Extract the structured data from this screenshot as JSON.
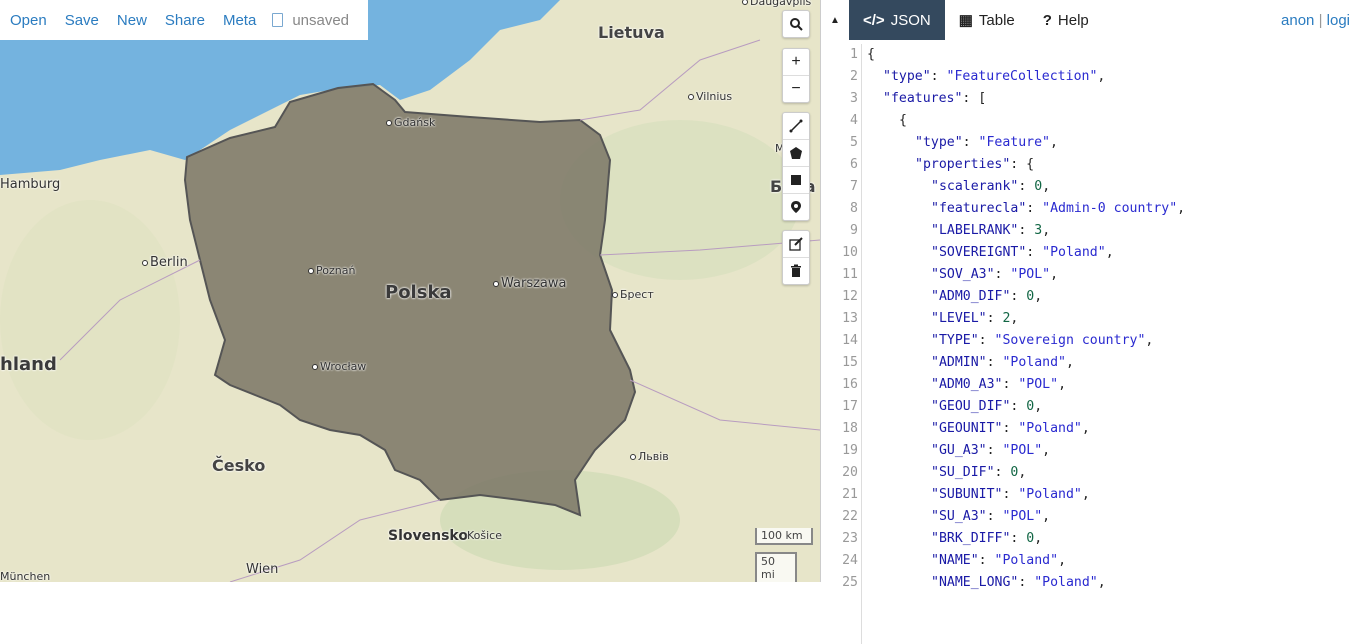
{
  "toolbar": {
    "open": "Open",
    "save": "Save",
    "new": "New",
    "share": "Share",
    "meta": "Meta",
    "unsaved": "unsaved"
  },
  "map": {
    "labels": {
      "daugavpils": "Daugavpils",
      "lietuva": "Lietuva",
      "vilnius": "Vilnius",
      "gdansk": "Gdańsk",
      "hamburg": "Hamburg",
      "berlin": "Berlin",
      "poznan": "Poznań",
      "polska": "Polska",
      "warszawa": "Warszawa",
      "brest": "Брест",
      "hland": "hland",
      "wroclaw": "Wrocław",
      "cesko": "Česko",
      "lviv": "Львів",
      "slovensko": "Slovensko",
      "kosice": "Košice",
      "wien": "Wien",
      "munchen": "München",
      "minsk_partial": "M",
      "belarus_partial": "Бела"
    },
    "scale_km": "100 km",
    "scale_mi": "50 mi",
    "colors": {
      "sea": "#74b3df",
      "land": "#e7e5c9",
      "polygon_fill": "#7a7565",
      "polygon_stroke": "#555555"
    }
  },
  "controls": {
    "search": "search-icon",
    "zoom_in": "+",
    "zoom_out": "−"
  },
  "panel": {
    "tabs": [
      {
        "label": "JSON",
        "icon": "</>"
      },
      {
        "label": "Table",
        "icon": "▦"
      },
      {
        "label": "Help",
        "icon": "?"
      }
    ],
    "user": {
      "anon": "anon",
      "separator": "|",
      "login": "logi"
    }
  },
  "editor": {
    "lines": [
      {
        "n": "1",
        "indent": 0,
        "parts": [
          [
            "p",
            "{"
          ]
        ]
      },
      {
        "n": "2",
        "indent": 1,
        "parts": [
          [
            "k",
            "\"type\""
          ],
          [
            "p",
            ": "
          ],
          [
            "s",
            "\"FeatureCollection\""
          ],
          [
            "p",
            ","
          ]
        ]
      },
      {
        "n": "3",
        "indent": 1,
        "parts": [
          [
            "k",
            "\"features\""
          ],
          [
            "p",
            ": ["
          ]
        ]
      },
      {
        "n": "4",
        "indent": 2,
        "parts": [
          [
            "p",
            "{"
          ]
        ]
      },
      {
        "n": "5",
        "indent": 3,
        "parts": [
          [
            "k",
            "\"type\""
          ],
          [
            "p",
            ": "
          ],
          [
            "s",
            "\"Feature\""
          ],
          [
            "p",
            ","
          ]
        ]
      },
      {
        "n": "6",
        "indent": 3,
        "parts": [
          [
            "k",
            "\"properties\""
          ],
          [
            "p",
            ": {"
          ]
        ]
      },
      {
        "n": "7",
        "indent": 4,
        "parts": [
          [
            "k",
            "\"scalerank\""
          ],
          [
            "p",
            ": "
          ],
          [
            "n",
            "0"
          ],
          [
            "p",
            ","
          ]
        ]
      },
      {
        "n": "8",
        "indent": 4,
        "parts": [
          [
            "k",
            "\"featurecla\""
          ],
          [
            "p",
            ": "
          ],
          [
            "s",
            "\"Admin-0 country\""
          ],
          [
            "p",
            ","
          ]
        ]
      },
      {
        "n": "9",
        "indent": 4,
        "parts": [
          [
            "k",
            "\"LABELRANK\""
          ],
          [
            "p",
            ": "
          ],
          [
            "n",
            "3"
          ],
          [
            "p",
            ","
          ]
        ]
      },
      {
        "n": "10",
        "indent": 4,
        "parts": [
          [
            "k",
            "\"SOVEREIGNT\""
          ],
          [
            "p",
            ": "
          ],
          [
            "s",
            "\"Poland\""
          ],
          [
            "p",
            ","
          ]
        ]
      },
      {
        "n": "11",
        "indent": 4,
        "parts": [
          [
            "k",
            "\"SOV_A3\""
          ],
          [
            "p",
            ": "
          ],
          [
            "s",
            "\"POL\""
          ],
          [
            "p",
            ","
          ]
        ]
      },
      {
        "n": "12",
        "indent": 4,
        "parts": [
          [
            "k",
            "\"ADM0_DIF\""
          ],
          [
            "p",
            ": "
          ],
          [
            "n",
            "0"
          ],
          [
            "p",
            ","
          ]
        ]
      },
      {
        "n": "13",
        "indent": 4,
        "parts": [
          [
            "k",
            "\"LEVEL\""
          ],
          [
            "p",
            ": "
          ],
          [
            "n",
            "2"
          ],
          [
            "p",
            ","
          ]
        ]
      },
      {
        "n": "14",
        "indent": 4,
        "parts": [
          [
            "k",
            "\"TYPE\""
          ],
          [
            "p",
            ": "
          ],
          [
            "s",
            "\"Sovereign country\""
          ],
          [
            "p",
            ","
          ]
        ]
      },
      {
        "n": "15",
        "indent": 4,
        "parts": [
          [
            "k",
            "\"ADMIN\""
          ],
          [
            "p",
            ": "
          ],
          [
            "s",
            "\"Poland\""
          ],
          [
            "p",
            ","
          ]
        ]
      },
      {
        "n": "16",
        "indent": 4,
        "parts": [
          [
            "k",
            "\"ADM0_A3\""
          ],
          [
            "p",
            ": "
          ],
          [
            "s",
            "\"POL\""
          ],
          [
            "p",
            ","
          ]
        ]
      },
      {
        "n": "17",
        "indent": 4,
        "parts": [
          [
            "k",
            "\"GEOU_DIF\""
          ],
          [
            "p",
            ": "
          ],
          [
            "n",
            "0"
          ],
          [
            "p",
            ","
          ]
        ]
      },
      {
        "n": "18",
        "indent": 4,
        "parts": [
          [
            "k",
            "\"GEOUNIT\""
          ],
          [
            "p",
            ": "
          ],
          [
            "s",
            "\"Poland\""
          ],
          [
            "p",
            ","
          ]
        ]
      },
      {
        "n": "19",
        "indent": 4,
        "parts": [
          [
            "k",
            "\"GU_A3\""
          ],
          [
            "p",
            ": "
          ],
          [
            "s",
            "\"POL\""
          ],
          [
            "p",
            ","
          ]
        ]
      },
      {
        "n": "20",
        "indent": 4,
        "parts": [
          [
            "k",
            "\"SU_DIF\""
          ],
          [
            "p",
            ": "
          ],
          [
            "n",
            "0"
          ],
          [
            "p",
            ","
          ]
        ]
      },
      {
        "n": "21",
        "indent": 4,
        "parts": [
          [
            "k",
            "\"SUBUNIT\""
          ],
          [
            "p",
            ": "
          ],
          [
            "s",
            "\"Poland\""
          ],
          [
            "p",
            ","
          ]
        ]
      },
      {
        "n": "22",
        "indent": 4,
        "parts": [
          [
            "k",
            "\"SU_A3\""
          ],
          [
            "p",
            ": "
          ],
          [
            "s",
            "\"POL\""
          ],
          [
            "p",
            ","
          ]
        ]
      },
      {
        "n": "23",
        "indent": 4,
        "parts": [
          [
            "k",
            "\"BRK_DIFF\""
          ],
          [
            "p",
            ": "
          ],
          [
            "n",
            "0"
          ],
          [
            "p",
            ","
          ]
        ]
      },
      {
        "n": "24",
        "indent": 4,
        "parts": [
          [
            "k",
            "\"NAME\""
          ],
          [
            "p",
            ": "
          ],
          [
            "s",
            "\"Poland\""
          ],
          [
            "p",
            ","
          ]
        ]
      },
      {
        "n": "25",
        "indent": 4,
        "parts": [
          [
            "k",
            "\"NAME_LONG\""
          ],
          [
            "p",
            ": "
          ],
          [
            "s",
            "\"Poland\""
          ],
          [
            "p",
            ","
          ]
        ]
      }
    ]
  }
}
